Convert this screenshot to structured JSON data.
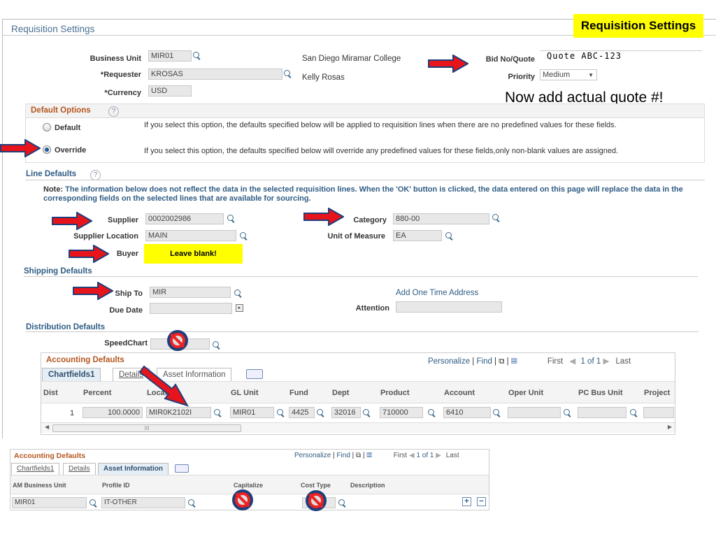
{
  "header": {
    "title": "Requisition Settings",
    "callout": "Requisition Settings",
    "note": "Now add actual quote #!"
  },
  "colors": {
    "callout_bg": "#ffff00",
    "arrow": "#e8141c",
    "arrow_outline": "#1f3f7a",
    "section_title": "#2f5c84",
    "grid_title": "#b5561f"
  },
  "settings": {
    "business_unit_label": "Business Unit",
    "business_unit": "MIR01",
    "business_unit_desc": "San Diego Miramar College",
    "requester_label": "*Requester",
    "requester": "KROSAS",
    "requester_desc": "Kelly Rosas",
    "currency_label": "*Currency",
    "currency": "USD",
    "bid_label": "Bid No/Quote",
    "bid": "Quote ABC-123",
    "priority_label": "Priority",
    "priority": "Medium"
  },
  "default_options": {
    "title": "Default Options",
    "help": "?",
    "default_label": "Default",
    "default_desc": "If you select this option, the defaults specified below will be applied to requisition lines when there are no predefined values for these fields.",
    "override_label": "Override",
    "override_desc": "If you select this option, the defaults specified below will override any predefined values for these fields,only non-blank values are assigned.",
    "selected": "Override"
  },
  "line_defaults": {
    "title": "Line Defaults",
    "help": "?",
    "note_bold": "Note:",
    "note": " The information below does not reflect the data in the selected requisition lines. When the 'OK' button is clicked, the data entered on this page will replace the data in the corresponding fields on the selected lines that are available for sourcing.",
    "supplier_label": "Supplier",
    "supplier": "0002002986",
    "category_label": "Category",
    "category": "880-00",
    "supplier_location_label": "Supplier Location",
    "supplier_location": "MAIN",
    "uom_label": "Unit of Measure",
    "uom": "EA",
    "buyer_label": "Buyer",
    "buyer_note": "Leave blank!"
  },
  "shipping_defaults": {
    "title": "Shipping Defaults",
    "ship_to_label": "Ship To",
    "ship_to": "MIR",
    "add_address": "Add One Time Address",
    "due_date_label": "Due Date",
    "attention_label": "Attention"
  },
  "distribution_defaults": {
    "title": "Distribution Defaults",
    "speedchart_label": "SpeedChart"
  },
  "grid1": {
    "title": "Accounting Defaults",
    "personalize": "Personalize",
    "find": "Find",
    "first": "First",
    "pager": "1 of 1",
    "last": "Last",
    "tabs": [
      "Chartfields1",
      "Details",
      "Asset Information"
    ],
    "columns": [
      "Dist",
      "Percent",
      "Location",
      "GL Unit",
      "Fund",
      "Dept",
      "Product",
      "Account",
      "Oper Unit",
      "PC Bus Unit",
      "Project"
    ],
    "row": [
      "1",
      "100.0000",
      "MIR0K2102I",
      "MIR01",
      "4425",
      "32016",
      "710000",
      "6410",
      "",
      "",
      ""
    ],
    "scroll_grip": "III"
  },
  "grid2": {
    "title": "Accounting Defaults",
    "personalize": "Personalize",
    "find": "Find",
    "first": "First",
    "pager": "1 of 1",
    "last": "Last",
    "tabs": [
      "Chartfields1",
      "Details",
      "Asset Information"
    ],
    "columns": [
      "AM Business Unit",
      "Profile ID",
      "Capitalize",
      "Cost Type",
      "Description"
    ],
    "row": [
      "MIR01",
      "IT-OTHER",
      "",
      "",
      ""
    ],
    "add": "+",
    "remove": "−"
  }
}
